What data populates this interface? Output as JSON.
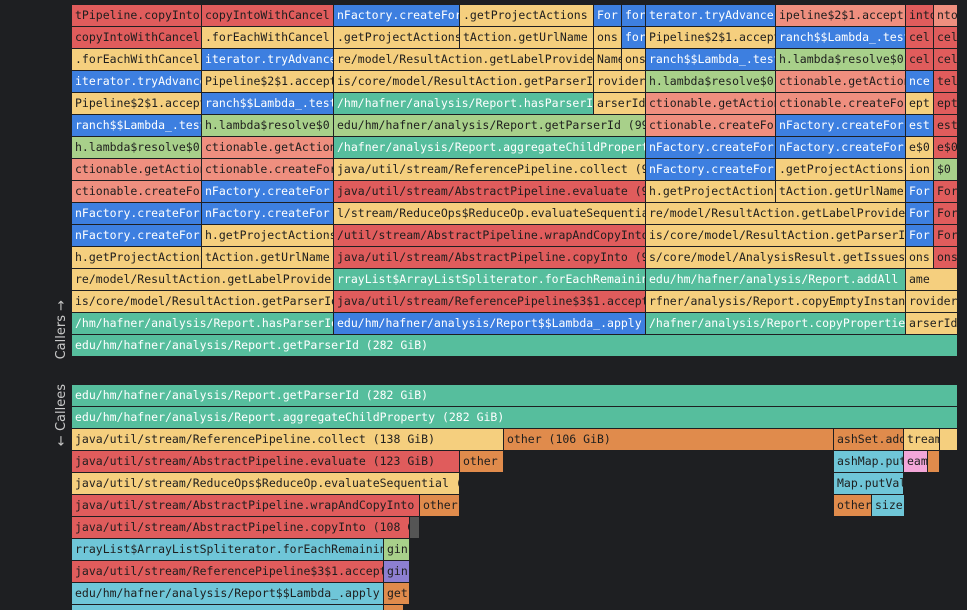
{
  "section_labels": {
    "callers": "Callers →",
    "callees": "← Callees"
  },
  "colors": {
    "teal": "#56be9d",
    "red": "#e05c5c",
    "blue": "#3d7fe0",
    "yellow": "#f5cf7e",
    "green": "#a8d08a",
    "salmon": "#ef8f7f",
    "orange": "#e08b4c",
    "pink": "#f3a6d8",
    "sky": "#6fc6d8",
    "purple": "#8d7fd1",
    "grey": "#555555"
  },
  "callers": [
    [
      "tPipeline.copyInto",
      "copyIntoWithCancel",
      "nFactory.createFor",
      ".getProjectActions",
      "For",
      "for",
      "terator.tryAdvance",
      "ipeline$2$1.accept",
      "into",
      "nto"
    ],
    [
      "copyIntoWithCancel",
      ".forEachWithCancel",
      ".getProjectActions",
      "tAction.getUrlName",
      "ons",
      "for",
      "Pipeline$2$1.accept",
      "ranch$$Lambda_.test",
      "cel",
      "cel"
    ],
    [
      ".forEachWithCancel",
      "iterator.tryAdvance",
      "re/model/ResultAction.getLabelProvider",
      "Name",
      "ons",
      "ranch$$Lambda_.test",
      "h.lambda$resolve$0",
      "cel",
      "cel"
    ],
    [
      "iterator.tryAdvance",
      "Pipeline$2$1.accept",
      "is/core/model/ResultAction.getParserId",
      "rovider",
      "h.lambda$resolve$0",
      "ctionable.getAction",
      "nce",
      "tel"
    ],
    [
      "Pipeline$2$1.accept",
      "ranch$$Lambda_.test",
      "/hm/hafner/analysis/Report.hasParserId",
      "arserId",
      "ctionable.getAction",
      "ctionable.createFor",
      "ept",
      "ept"
    ],
    [
      "ranch$$Lambda_.test",
      "h.lambda$resolve$0",
      "edu/hm/hafner/analysis/Report.getParserId (99.",
      "ctionable.createFor",
      "nFactory.createFor",
      "est",
      "est"
    ],
    [
      "h.lambda$resolve$0",
      "ctionable.getAction",
      "/hafner/analysis/Report.aggregateChildProperty",
      "nFactory.createFor",
      "nFactory.createFor",
      "e$0",
      "e$0"
    ],
    [
      "ctionable.getAction",
      "ctionable.createFor",
      "java/util/stream/ReferencePipeline.collect (99",
      "nFactory.createFor",
      ".getProjectActions",
      "ion",
      "$0"
    ],
    [
      "ctionable.createFor",
      "nFactory.createFor",
      "java/util/stream/AbstractPipeline.evaluate (99",
      "h.getProjectActions",
      "tAction.getUrlName",
      "For",
      "For"
    ],
    [
      "nFactory.createFor",
      "nFactory.createFor",
      "l/stream/ReduceOps$ReduceOp.evaluateSequential",
      "re/model/ResultAction.getLabelProvider",
      "For",
      "For"
    ],
    [
      "nFactory.createFor",
      "h.getProjectActions",
      "/util/stream/AbstractPipeline.wrapAndCopyInto",
      "is/core/model/ResultAction.getParserId",
      "For",
      "For"
    ],
    [
      "h.getProjectActions",
      "tAction.getUrlName",
      "java/util/stream/AbstractPipeline.copyInto (99",
      "s/core/model/AnalysisResult.getIssues",
      "ons",
      "ons"
    ],
    [
      "re/model/ResultAction.getLabelProvider",
      "rrayList$ArrayListSpliterator.forEachRemaining",
      "edu/hm/hafner/analysis/Report.addAll (Name",
      "ame"
    ],
    [
      "is/core/model/ResultAction.getParserId",
      "java/util/stream/ReferencePipeline$3$1.accept",
      "rfner/analysis/Report.copyEmptyInstance",
      "rovider"
    ],
    [
      "/hm/hafner/analysis/Report.hasParserId",
      "edu/hm/hafner/analysis/Report$$Lambda_.apply (",
      "/hafner/analysis/Report.copyProperties",
      "arserId"
    ],
    [
      "edu/hm/hafner/analysis/Report.getParserId (282 GiB)"
    ]
  ],
  "callees": [
    [
      "edu/hm/hafner/analysis/Report.getParserId (282 GiB)"
    ],
    [
      "edu/hm/hafner/analysis/Report.aggregateChildProperty (282 GiB)"
    ],
    [
      "java/util/stream/ReferencePipeline.collect (138 GiB)",
      "other (106 GiB)",
      "ashSet.add",
      "tream",
      ""
    ],
    [
      "java/util/stream/AbstractPipeline.evaluate (123 GiB)",
      "other",
      "ashMap.put",
      "eam",
      ""
    ],
    [
      "java/util/stream/ReduceOps$ReduceOp.evaluateSequential (1",
      "Map.putVal"
    ],
    [
      "java/util/stream/AbstractPipeline.wrapAndCopyInto (",
      "other",
      "other",
      "size"
    ],
    [
      "java/util/stream/AbstractPipeline.copyInto (108 G",
      ""
    ],
    [
      "rrayList$ArrayListSpliterator.forEachRemaining",
      "gin"
    ],
    [
      "java/util/stream/ReferencePipeline$3$1.accept",
      "gin"
    ],
    [
      "edu/hm/hafner/analysis/Report$$Lambda_.apply (",
      "get"
    ],
    [
      "",
      ""
    ]
  ]
}
